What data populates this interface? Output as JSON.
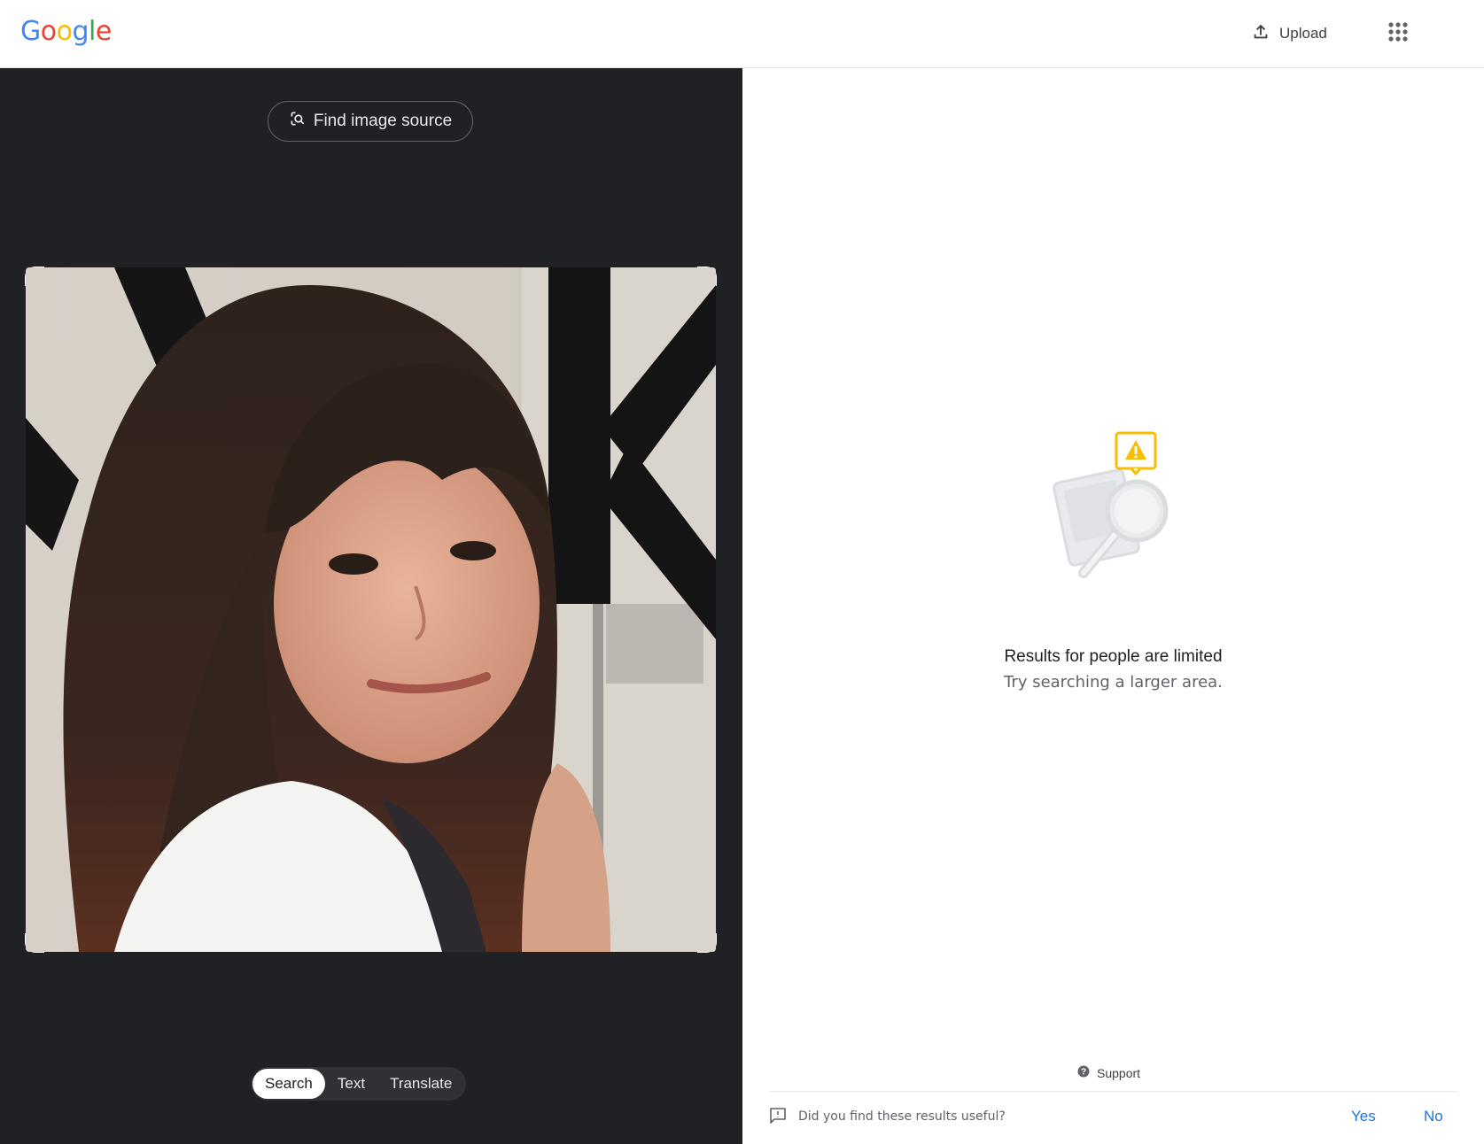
{
  "header": {
    "logo_letters": [
      {
        "ch": "G",
        "color": "#4285F4"
      },
      {
        "ch": "o",
        "color": "#EA4335"
      },
      {
        "ch": "o",
        "color": "#FBBC05"
      },
      {
        "ch": "g",
        "color": "#4285F4"
      },
      {
        "ch": "l",
        "color": "#34A853"
      },
      {
        "ch": "e",
        "color": "#EA4335"
      }
    ],
    "upload_label": "Upload",
    "upload_icon": "upload-icon",
    "apps_icon": "apps-grid-icon"
  },
  "left_panel": {
    "find_source_label": "Find image source",
    "find_source_icon": "lens-search-icon",
    "image_content": "photo-portrait",
    "mode_tabs": [
      {
        "label": "Search",
        "active": true
      },
      {
        "label": "Text",
        "active": false
      },
      {
        "label": "Translate",
        "active": false
      }
    ]
  },
  "right_panel": {
    "illustration_icon": "limited-results-warning-icon",
    "message_title": "Results for people are limited",
    "message_subtitle": "Try searching a larger area.",
    "support_label": "Support",
    "support_icon": "help-circle-icon",
    "feedback": {
      "question": "Did you find these results useful?",
      "icon": "feedback-icon",
      "yes_label": "Yes",
      "no_label": "No"
    }
  },
  "colors": {
    "left_bg": "#202124",
    "accent_link": "#1a73e8",
    "warning_yellow": "#FBBC04"
  }
}
